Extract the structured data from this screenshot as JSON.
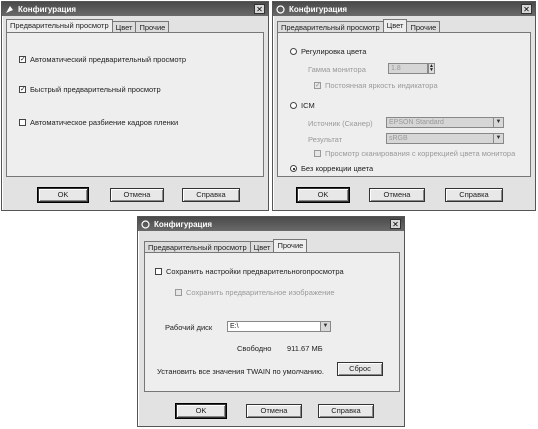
{
  "win1": {
    "title": "Конфигурация",
    "tabs": [
      "Предварительный просмотр",
      "Цвет",
      "Прочие"
    ],
    "checks": [
      {
        "label": "Автоматический предварительный просмотр",
        "checked": true
      },
      {
        "label": "Быстрый предварительный просмотр",
        "checked": true
      },
      {
        "label": "Автоматическое разбиение кадров пленки",
        "checked": false
      }
    ],
    "buttons": {
      "ok": "OK",
      "cancel": "Отмена",
      "help": "Справка"
    }
  },
  "win2": {
    "title": "Конфигурация",
    "tabs": [
      "Предварительный просмотр",
      "Цвет",
      "Прочие"
    ],
    "color_adjust": "Регулировка цвета",
    "gamma_label": "Гамма монитора",
    "gamma_value": "1.8",
    "display_check": "Постоянная яркость индикатора",
    "icm": "ICM",
    "source_label": "Источник (Сканер)",
    "source_value": "EPSON Standard",
    "target_label": "Результат",
    "target_value": "sRGB",
    "preview_icm": "Просмотр сканирования с коррекцией цвета монитора",
    "no_color": "Без коррекции цвета",
    "buttons": {
      "ok": "OK",
      "cancel": "Отмена",
      "help": "Справка"
    }
  },
  "win3": {
    "title": "Конфигурация",
    "tabs": [
      "Предварительный просмотр",
      "Цвет",
      "Прочие"
    ],
    "save_settings": "Сохранить настройки предварительногопросмотра",
    "save_image": "Сохранить предварительное изображение",
    "disk_label": "Рабочий диск",
    "disk_value": "E:\\",
    "free_label": "Свободно",
    "free_value": "911.67 МБ",
    "reset_text": "Установить все значения TWAIN по умолчанию.",
    "reset_button": "Сброс",
    "buttons": {
      "ok": "OK",
      "cancel": "Отмена",
      "help": "Справка"
    }
  }
}
